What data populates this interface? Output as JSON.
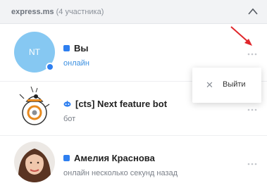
{
  "header": {
    "group_name": "express.ms",
    "member_count": "(4 участника)",
    "collapse_icon": "chevron-up-icon"
  },
  "members": [
    {
      "initials": "NT",
      "name": "Вы",
      "status": "онлайн",
      "type_icon": "user-icon",
      "online": true
    },
    {
      "name": "[cts] Next feature bot",
      "status": "бот",
      "type_icon": "bot-icon",
      "avatar": "bb8-robot"
    },
    {
      "name": "Амелия Краснова",
      "status": "онлайн несколько секунд назад",
      "type_icon": "user-icon",
      "avatar": "photo"
    }
  ],
  "popup": {
    "leave_label": "Выйти",
    "icon": "close-icon"
  },
  "colors": {
    "accent": "#2e7ff0",
    "online_text": "#3a8fe0",
    "avatar_bg": "#86c8f2",
    "annotation_arrow": "#e0262b"
  }
}
